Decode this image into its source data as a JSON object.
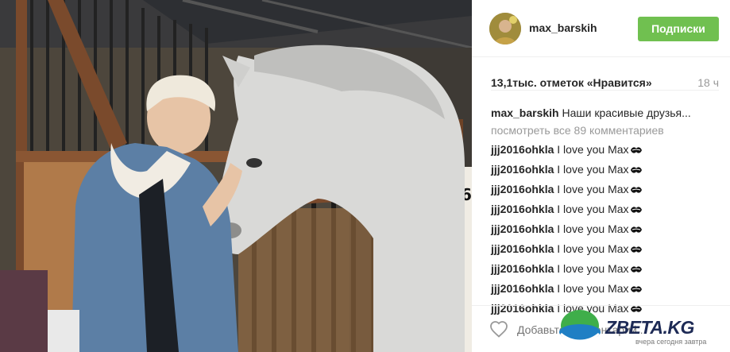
{
  "post": {
    "username": "max_barskih",
    "follow_label": "Подписки",
    "likes_text": "13,1тыс. отметок «Нравится»",
    "time_ago": "18 ч",
    "caption": {
      "user": "max_barskih",
      "text": "Наши красивые друзья..."
    },
    "view_all_comments": "посмотреть все 89 комментариев",
    "comments": [
      {
        "user": "jjj2016ohkla",
        "text": "I love you Max",
        "emoji": "kiss-mark-icon"
      },
      {
        "user": "jjj2016ohkla",
        "text": "I love you Max",
        "emoji": "kiss-mark-icon"
      },
      {
        "user": "jjj2016ohkla",
        "text": "I love you Max",
        "emoji": "kiss-mark-icon"
      },
      {
        "user": "jjj2016ohkla",
        "text": "I love you Max",
        "emoji": "kiss-mark-icon"
      },
      {
        "user": "jjj2016ohkla",
        "text": "I love you Max",
        "emoji": "kiss-mark-icon"
      },
      {
        "user": "jjj2016ohkla",
        "text": "I love you Max",
        "emoji": "kiss-mark-icon"
      },
      {
        "user": "jjj2016ohkla",
        "text": "I love you Max",
        "emoji": "kiss-mark-icon"
      },
      {
        "user": "jjj2016ohkla",
        "text": "I love you Max",
        "emoji": "kiss-mark-icon"
      },
      {
        "user": "jjj2016ohkla",
        "text": "I love you Max",
        "emoji": "kiss-mark-icon"
      }
    ],
    "add_comment_placeholder": "Добавьте комментарий..."
  },
  "watermark": {
    "brand": "ZBETA.KG",
    "tagline": "вчера сегодня завтра"
  },
  "colors": {
    "follow_button": "#70c050",
    "muted_text": "#999999",
    "text": "#262626",
    "divider": "#efefef"
  }
}
